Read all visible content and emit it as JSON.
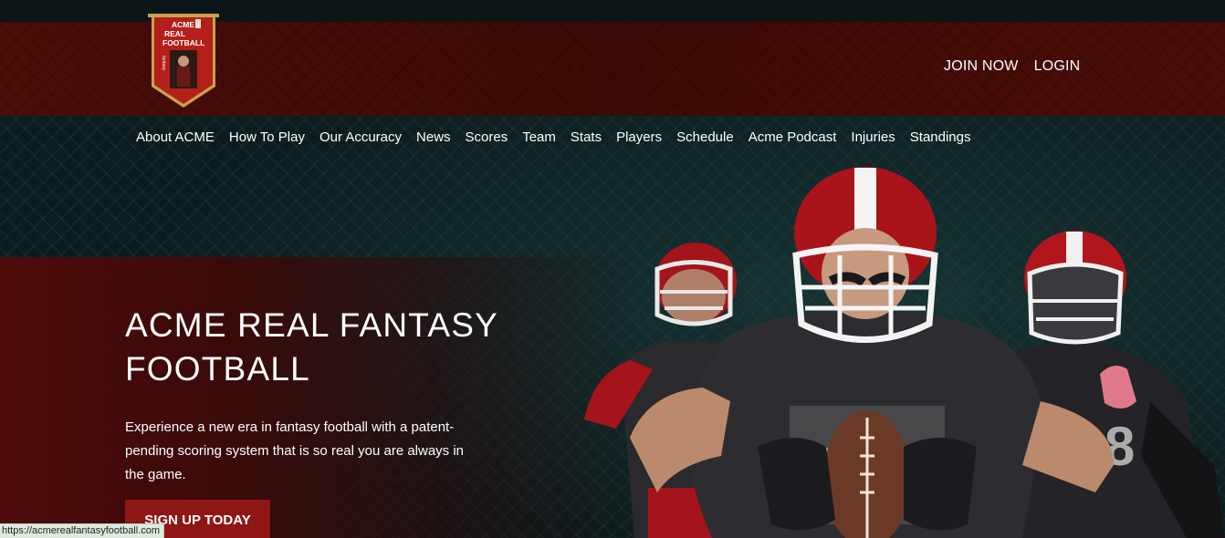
{
  "logo": {
    "line1": "ACME",
    "line2": "REAL",
    "line3": "FOOTBALL",
    "vertical": "fantasy"
  },
  "header": {
    "join_label": "JOIN NOW",
    "login_label": "LOGIN"
  },
  "nav": {
    "items": [
      {
        "label": "About ACME"
      },
      {
        "label": "How To Play"
      },
      {
        "label": "Our Accuracy"
      },
      {
        "label": "News"
      },
      {
        "label": "Scores"
      },
      {
        "label": "Team"
      },
      {
        "label": "Stats"
      },
      {
        "label": "Players"
      },
      {
        "label": "Schedule"
      },
      {
        "label": "Acme Podcast"
      },
      {
        "label": "Injuries"
      },
      {
        "label": "Standings"
      }
    ]
  },
  "hero": {
    "title": "ACME REAL FANTASY FOOTBALL",
    "text": "Experience a new era in fantasy football with a patent-pending scoring system that is so real you are always in the game.",
    "cta_label": "SIGN UP TODAY",
    "jersey_number": "88"
  },
  "status": {
    "url": "https://acmerealfantasyfootball.com"
  },
  "colors": {
    "brand_red": "#8e1614",
    "header_band": "#4a0d08",
    "background": "#0c1c1e",
    "text": "#ffffff"
  }
}
